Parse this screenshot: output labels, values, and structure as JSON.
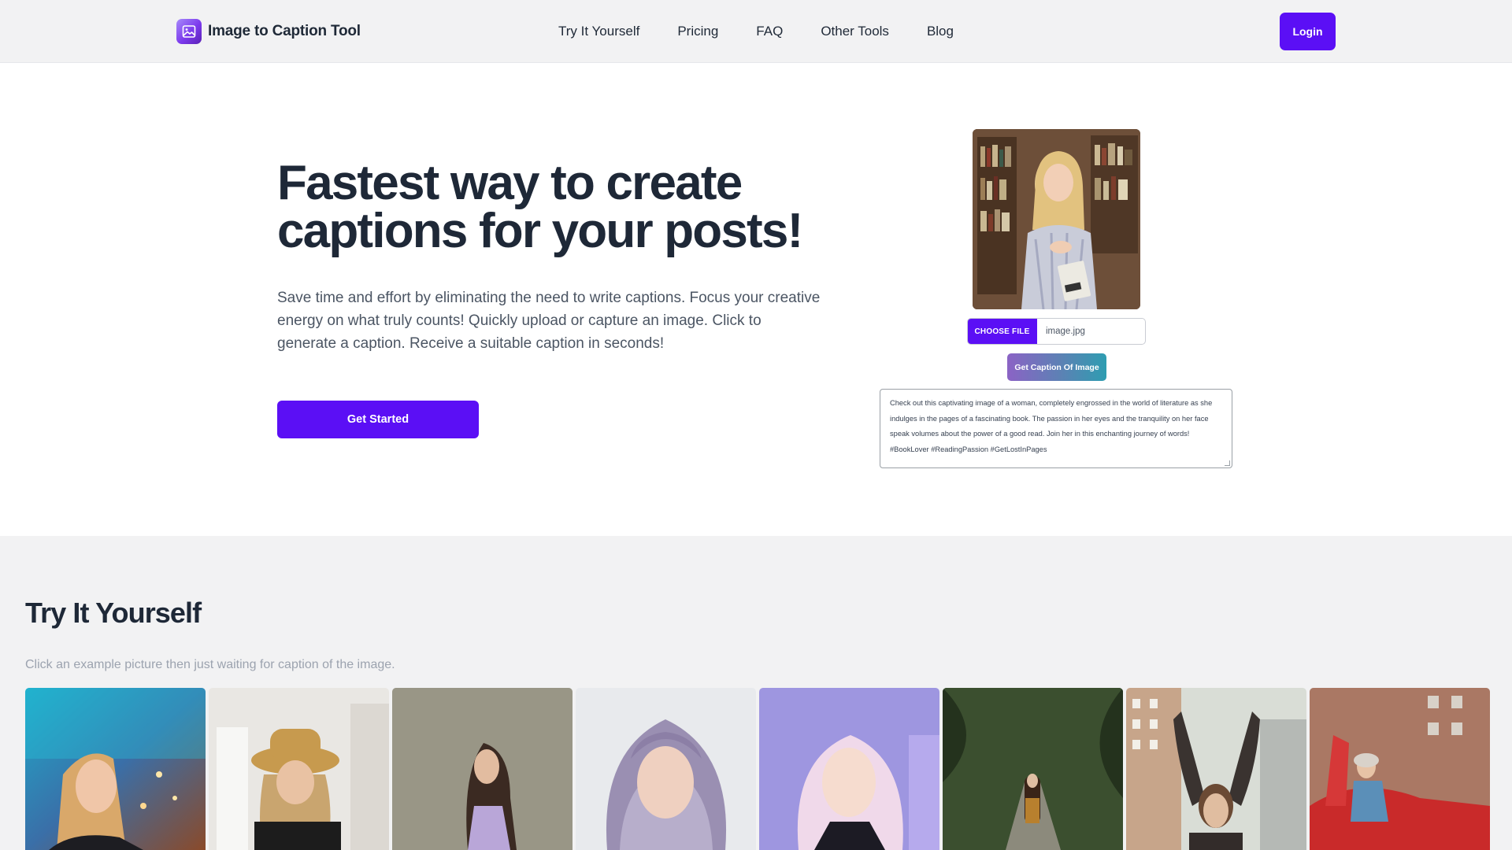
{
  "header": {
    "logo_text": "Image to Caption Tool",
    "logo_icon": "image-icon",
    "nav": [
      "Try It Yourself",
      "Pricing",
      "FAQ",
      "Other Tools",
      "Blog"
    ],
    "login_label": "Login"
  },
  "hero": {
    "title_line1": "Fastest way to create",
    "title_line2": "captions for your posts!",
    "description": "Save time and effort by eliminating the need to write captions. Focus your creative energy on what truly counts! Quickly upload or capture an image. Click to generate a caption. Receive a suitable caption in seconds!",
    "cta_label": "Get Started"
  },
  "demo": {
    "choose_file_label": "CHOOSE FILE",
    "file_name": "image.jpg",
    "get_caption_label": "Get Caption Of Image",
    "caption_text": "Check out this captivating image of a woman, completely engrossed in the world of literature as she indulges in the pages of a fascinating book. The passion in her eyes and the tranquility on her face speak volumes about the power of a good read. Join her in this enchanting journey of words! #BookLover #ReadingPassion #GetLostInPages"
  },
  "try_section": {
    "title": "Try It Yourself",
    "subtitle": "Click an example picture then just waiting for caption of the image."
  },
  "colors": {
    "accent": "#5b0ff5",
    "heading": "#1e2837",
    "section_bg": "#f2f2f3"
  }
}
